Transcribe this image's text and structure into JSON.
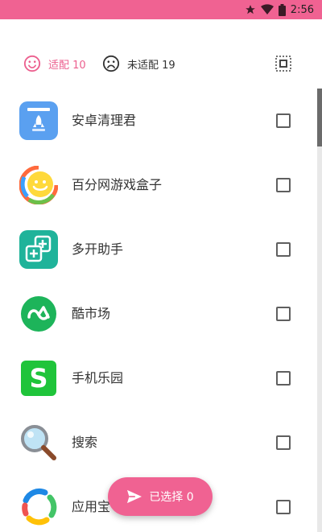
{
  "status_bar": {
    "time": "2:56",
    "icons": [
      "star-icon",
      "wifi-icon",
      "battery-icon"
    ],
    "background": "#f06292"
  },
  "tabs": {
    "adapted_label": "适配 10",
    "adapted_icon": "smile-icon",
    "unadapted_label": "未适配 19",
    "unadapted_icon": "frown-icon",
    "select_all_icon": "select-all-icon",
    "active_color": "#ec5f8e"
  },
  "apps": [
    {
      "name": "安卓清理君",
      "icon": "rocket-cleaner-icon",
      "checked": false
    },
    {
      "name": "百分网游戏盒子",
      "icon": "smiley-game-box-icon",
      "checked": false
    },
    {
      "name": "多开助手",
      "icon": "multi-open-icon",
      "checked": false
    },
    {
      "name": "酷市场",
      "icon": "coolapk-icon",
      "checked": false
    },
    {
      "name": "手机乐园",
      "icon": "s-icon",
      "checked": false
    },
    {
      "name": "搜索",
      "icon": "magnifier-icon",
      "checked": false
    },
    {
      "name": "应用宝",
      "icon": "app-store-icon",
      "checked": false
    }
  ],
  "fab": {
    "label": "已选择 0",
    "icon": "send-icon",
    "color": "#f06292"
  }
}
